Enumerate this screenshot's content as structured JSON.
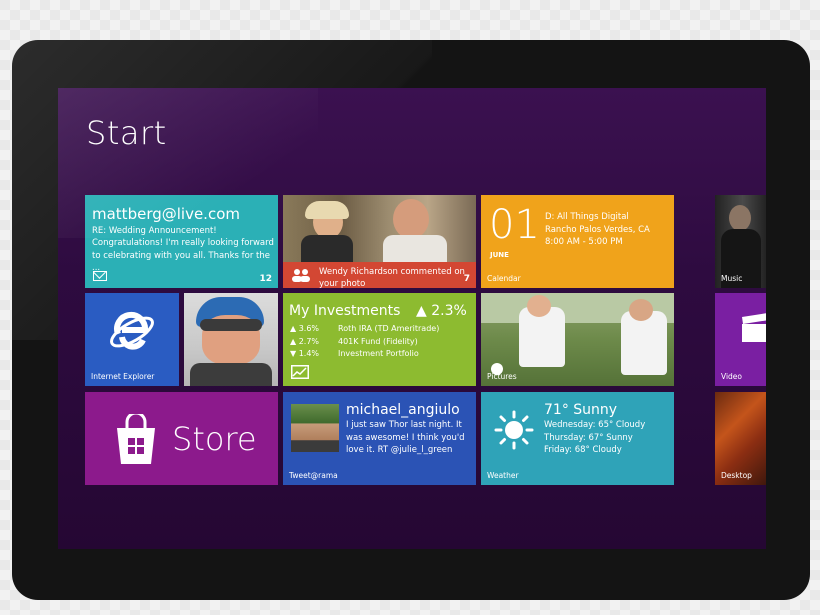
{
  "screen": {
    "title": "Start"
  },
  "tiles": {
    "mail": {
      "address": "mattberg@live.com",
      "subject": "RE: Wedding Announcement!",
      "body": "Congratulations! I'm really looking forward to celebrating with you all. Thanks for the ...",
      "count": "12",
      "icon": "mail-icon"
    },
    "people": {
      "notification": "Wendy Richardson commented on your photo",
      "count": "7",
      "icon": "people-icon"
    },
    "calendar": {
      "day": "01",
      "month": "JUNE",
      "event_title": "D: All Things Digital",
      "location": "Rancho Palos Verdes, CA",
      "time": "8:00 AM - 5:00 PM",
      "label": "Calendar"
    },
    "music": {
      "label": "Music"
    },
    "ie": {
      "label": "Internet Explorer",
      "icon": "ie-logo-icon"
    },
    "investments": {
      "title": "My Investments",
      "change": "▲ 2.3%",
      "rows": [
        {
          "change": "▲ 3.6%",
          "name": "Roth IRA (TD Ameritrade)"
        },
        {
          "change": "▲ 2.7%",
          "name": "401K Fund (Fidelity)"
        },
        {
          "change": "▼ 1.4%",
          "name": "Investment Portfolio"
        }
      ],
      "icon": "stock-chart-icon"
    },
    "pictures": {
      "label": "Pictures"
    },
    "video": {
      "label": "Video",
      "icon": "clapperboard-icon"
    },
    "store": {
      "label": "Store",
      "icon": "shopping-bag-icon"
    },
    "tweet": {
      "user": "michael_angiulo",
      "text": "I just saw Thor last night. It was awesome! I think you'd love it. RT @julie_l_green",
      "label": "Tweet@rama"
    },
    "weather": {
      "current": "71° Sunny",
      "forecast": [
        "Wednesday: 65° Cloudy",
        "Thursday: 67° Sunny",
        "Friday: 68° Cloudy"
      ],
      "label": "Weather",
      "icon": "sun-icon"
    },
    "desktop": {
      "label": "Desktop"
    }
  }
}
